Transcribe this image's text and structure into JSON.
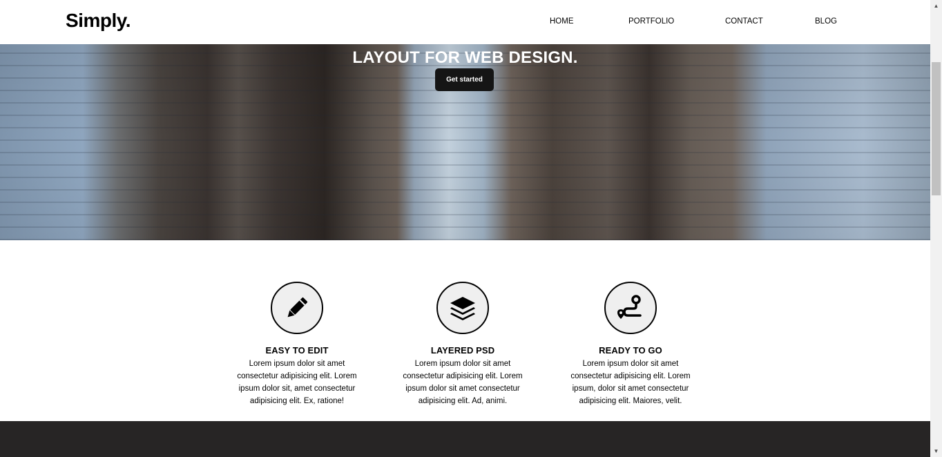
{
  "header": {
    "logo": "Simply.",
    "nav": [
      "HOME",
      "PORTFOLIO",
      "CONTACT",
      "BLOG"
    ]
  },
  "hero": {
    "title": "LAYOUT FOR WEB DESIGN.",
    "button_label": "Get started"
  },
  "features": [
    {
      "icon": "pencil-icon",
      "title": "EASY TO EDIT",
      "text": "Lorem ipsum dolor sit amet consectetur adipisicing elit. Lorem ipsum dolor sit, amet consectetur adipisicing elit. Ex, ratione!"
    },
    {
      "icon": "layers-icon",
      "title": "LAYERED PSD",
      "text": "Lorem ipsum dolor sit amet consectetur adipisicing elit. Lorem ipsum dolor sit amet consectetur adipisicing elit. Ad, animi."
    },
    {
      "icon": "route-icon",
      "title": "READY TO GO",
      "text": "Lorem ipsum dolor sit amet consectetur adipisicing elit. Lorem ipsum, dolor sit amet consectetur adipisicing elit. Maiores, velit."
    }
  ],
  "colors": {
    "button_bg": "#151515",
    "footer_bg": "#272525",
    "icon_circle_bg": "#efefef"
  }
}
